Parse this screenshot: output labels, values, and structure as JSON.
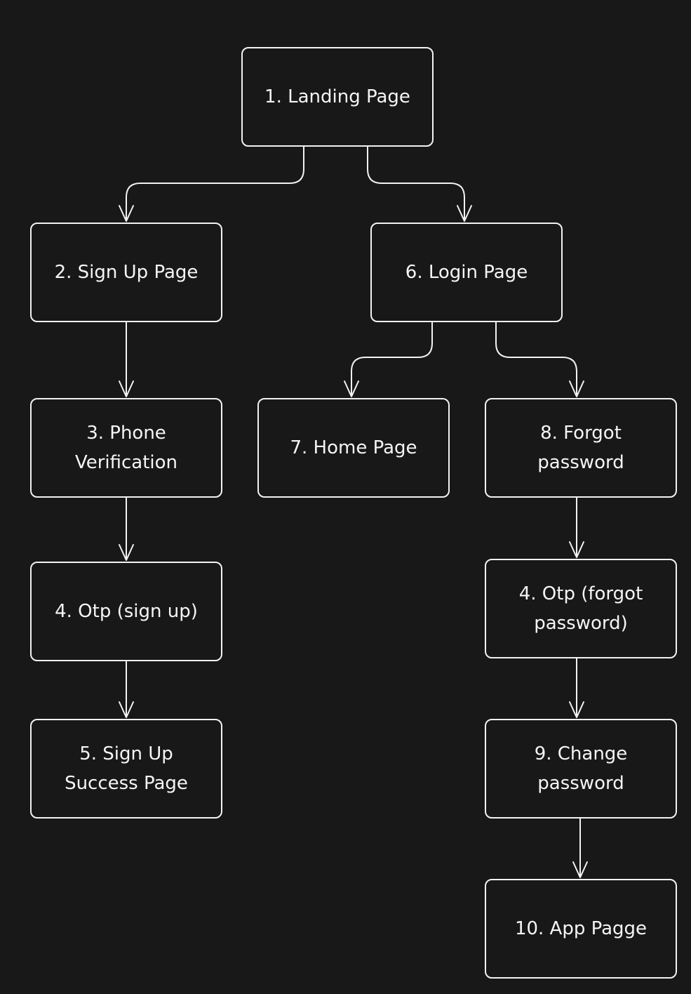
{
  "colors": {
    "background": "#181818",
    "stroke": "#f2f2f2",
    "text": "#f5f5f5"
  },
  "nodes": [
    {
      "id": "n1",
      "label": "1. Landing Page"
    },
    {
      "id": "n2",
      "label": "2. Sign Up Page"
    },
    {
      "id": "n6",
      "label": "6. Login Page"
    },
    {
      "id": "n3",
      "label": "3. Phone Verification"
    },
    {
      "id": "n7",
      "label": "7. Home Page"
    },
    {
      "id": "n8",
      "label": "8. Forgot password"
    },
    {
      "id": "n4a",
      "label": "4. Otp (sign up)"
    },
    {
      "id": "n4b",
      "label": "4. Otp (forgot password)"
    },
    {
      "id": "n5",
      "label": "5. Sign Up Success Page"
    },
    {
      "id": "n9",
      "label": "9. Change password"
    },
    {
      "id": "n10",
      "label": "10. App Pagge"
    }
  ],
  "edges": [
    {
      "from": "n1",
      "to": "n2"
    },
    {
      "from": "n1",
      "to": "n6"
    },
    {
      "from": "n2",
      "to": "n3"
    },
    {
      "from": "n6",
      "to": "n7"
    },
    {
      "from": "n6",
      "to": "n8"
    },
    {
      "from": "n3",
      "to": "n4a"
    },
    {
      "from": "n4a",
      "to": "n5"
    },
    {
      "from": "n8",
      "to": "n4b"
    },
    {
      "from": "n4b",
      "to": "n9"
    },
    {
      "from": "n9",
      "to": "n10"
    }
  ]
}
